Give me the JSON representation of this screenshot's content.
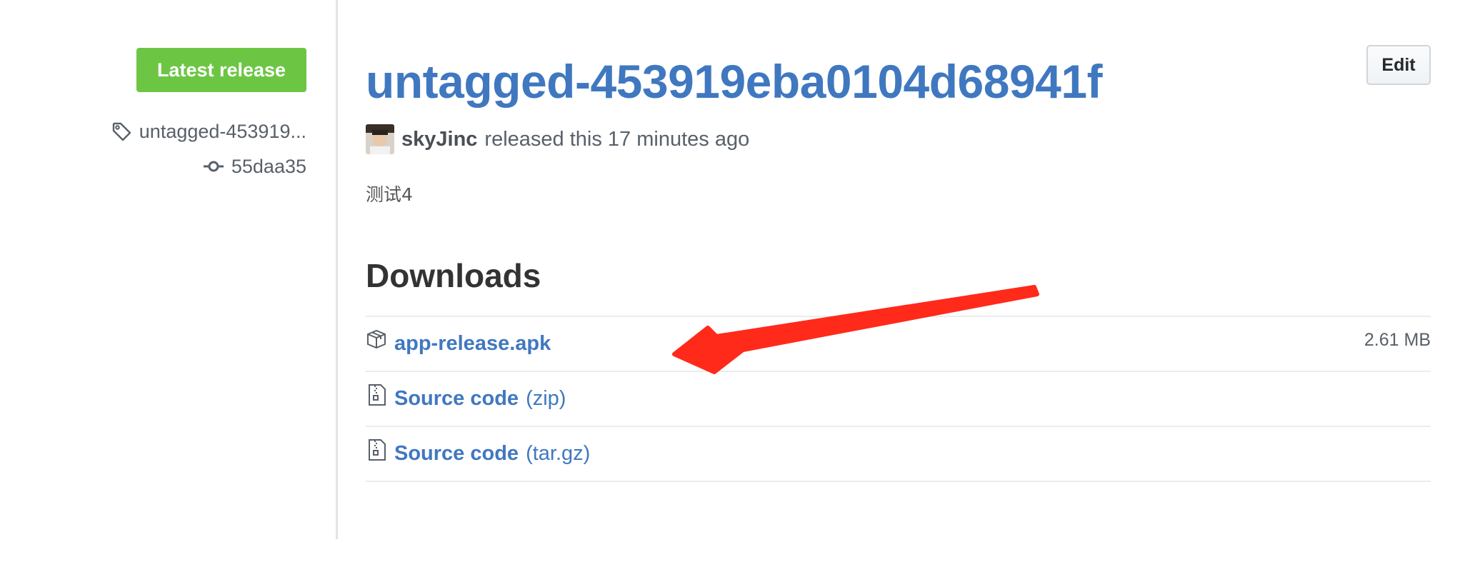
{
  "sidebar": {
    "latest_label": "Latest release",
    "tag_label": "untagged-453919...",
    "commit_label": "55daa35"
  },
  "release": {
    "title": "untagged-453919eba0104d68941f",
    "edit_label": "Edit",
    "author": "skyJinc",
    "meta_text": "released this 17 minutes ago",
    "body": "测试4"
  },
  "downloads": {
    "heading": "Downloads",
    "items": [
      {
        "name": "app-release.apk",
        "suffix": "",
        "size": "2.61 MB",
        "icon": "package-icon"
      },
      {
        "name": "Source code",
        "suffix": "(zip)",
        "size": "",
        "icon": "file-zip-icon"
      },
      {
        "name": "Source code",
        "suffix": "(tar.gz)",
        "size": "",
        "icon": "file-zip-icon"
      }
    ]
  },
  "colors": {
    "link": "#4078c0",
    "badge_green": "#6cc644",
    "annotation_arrow": "#ff2a1a"
  }
}
